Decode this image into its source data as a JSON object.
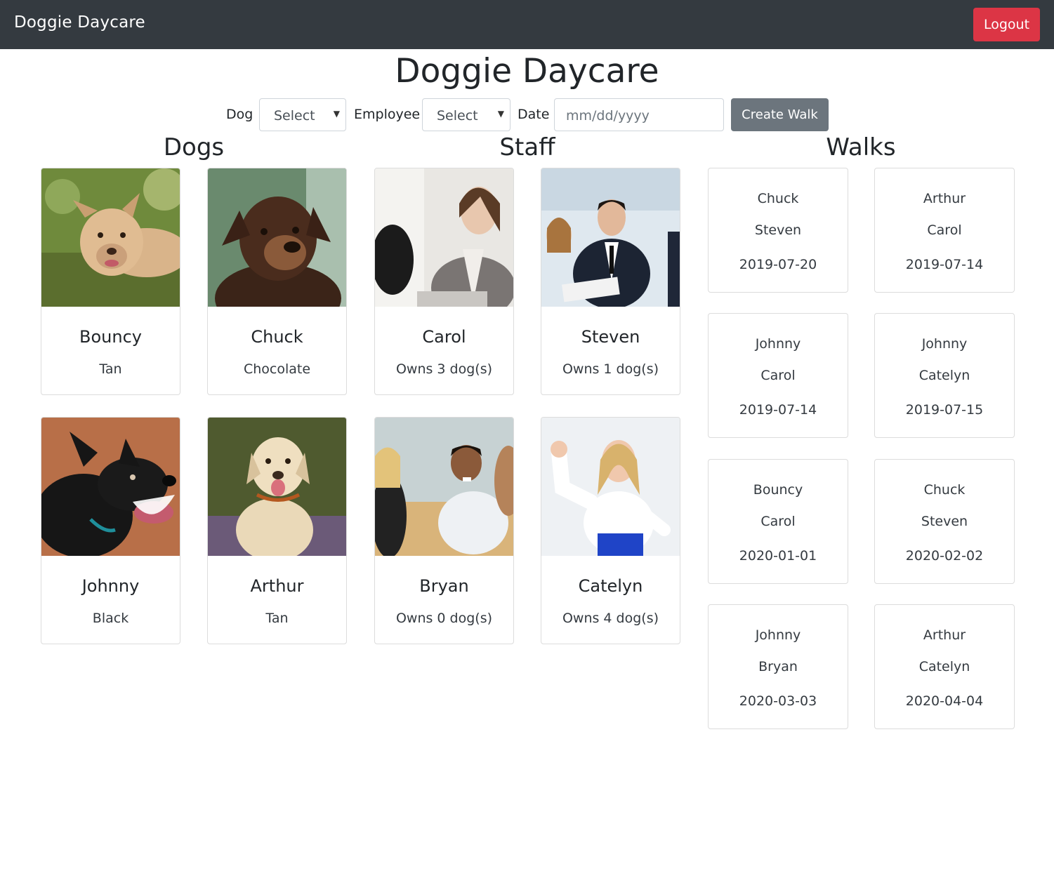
{
  "navbar": {
    "brand": "Doggie Daycare",
    "logout_label": "Logout",
    "logout_color": "#dc3545",
    "bg_color": "#343a40"
  },
  "page_title": "Doggie Daycare",
  "form": {
    "dog_label": "Dog",
    "dog_value": "Select",
    "employee_label": "Employee",
    "employee_value": "Select",
    "date_label": "Date",
    "date_placeholder": "mm/dd/yyyy",
    "create_label": "Create Walk"
  },
  "sections": {
    "dogs": "Dogs",
    "staff": "Staff",
    "walks": "Walks"
  },
  "dogs": [
    {
      "name": "Bouncy",
      "color": "Tan",
      "photo_icon": "tan-puppy-photo"
    },
    {
      "name": "Chuck",
      "color": "Chocolate",
      "photo_icon": "brown-dog-photo"
    },
    {
      "name": "Johnny",
      "color": "Black",
      "photo_icon": "black-dog-photo"
    },
    {
      "name": "Arthur",
      "color": "Tan",
      "photo_icon": "labrador-photo"
    }
  ],
  "staff": [
    {
      "name": "Carol",
      "owns": "Owns 3 dog(s)",
      "photo_icon": "businesswoman-photo"
    },
    {
      "name": "Steven",
      "owns": "Owns 1 dog(s)",
      "photo_icon": "businessman-photo"
    },
    {
      "name": "Bryan",
      "owns": "Owns 0 dog(s)",
      "photo_icon": "office-team-photo"
    },
    {
      "name": "Catelyn",
      "owns": "Owns 4 dog(s)",
      "photo_icon": "strong-woman-photo"
    }
  ],
  "walks": [
    {
      "dog": "Chuck",
      "employee": "Steven",
      "date": "2019-07-20"
    },
    {
      "dog": "Arthur",
      "employee": "Carol",
      "date": "2019-07-14"
    },
    {
      "dog": "Johnny",
      "employee": "Carol",
      "date": "2019-07-14"
    },
    {
      "dog": "Johnny",
      "employee": "Catelyn",
      "date": "2019-07-15"
    },
    {
      "dog": "Bouncy",
      "employee": "Carol",
      "date": "2020-01-01"
    },
    {
      "dog": "Chuck",
      "employee": "Steven",
      "date": "2020-02-02"
    },
    {
      "dog": "Johnny",
      "employee": "Bryan",
      "date": "2020-03-03"
    },
    {
      "dog": "Arthur",
      "employee": "Catelyn",
      "date": "2020-04-04"
    }
  ]
}
